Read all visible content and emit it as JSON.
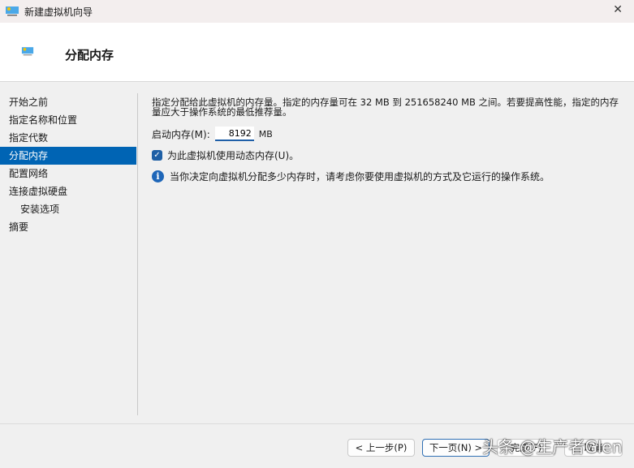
{
  "window": {
    "title": "新建虚拟机向导"
  },
  "header": {
    "title": "分配内存"
  },
  "nav": [
    {
      "label": "开始之前"
    },
    {
      "label": "指定名称和位置"
    },
    {
      "label": "指定代数"
    },
    {
      "label": "分配内存",
      "active": true
    },
    {
      "label": "配置网络"
    },
    {
      "label": "连接虚拟硬盘"
    },
    {
      "label": "安装选项"
    },
    {
      "label": "摘要"
    }
  ],
  "main": {
    "description": "指定分配给此虚拟机的内存量。指定的内存量可在 32 MB 到 251658240 MB 之间。若要提高性能，指定的内存量应大于操作系统的最低推荐量。",
    "startup_label": "启动内存(M):",
    "startup_value": "8192",
    "unit": "MB",
    "dynamic_label": "为此虚拟机使用动态内存(U)。",
    "dynamic_checked": true,
    "info": "当你决定向虚拟机分配多少内存时，请考虑你要使用虚拟机的方式及它运行的操作系统。"
  },
  "footer": {
    "prev": "< 上一步(P)",
    "next": "下一页(N) >",
    "finish": "完成(F)",
    "cancel": "取消"
  },
  "watermark": "头条 @生产者Glen"
}
